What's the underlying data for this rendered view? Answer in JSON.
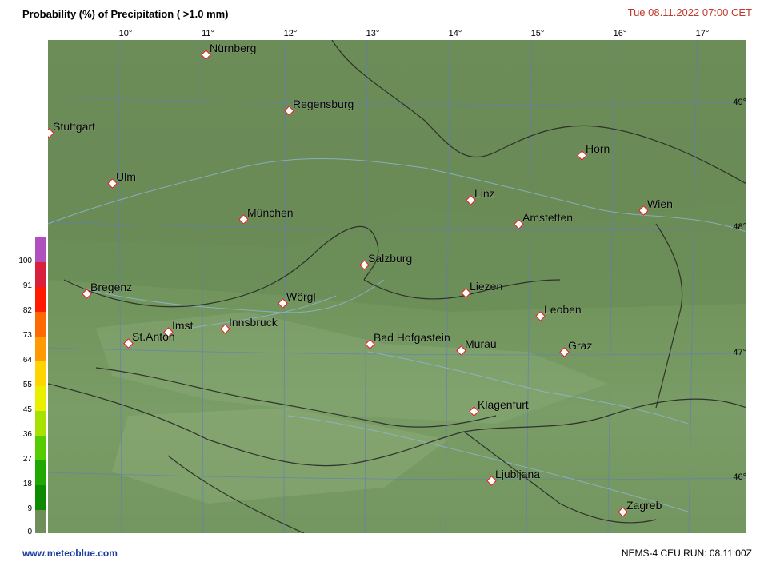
{
  "header": {
    "title": "Probability (%) of Precipitation ( >1.0 mm)",
    "datetime": "Tue 08.11.2022  07:00 CET"
  },
  "lon_labels": [
    "10°",
    "11°",
    "12°",
    "13°",
    "14°",
    "15°",
    "16°",
    "17°"
  ],
  "lat_labels": [
    "49°",
    "48°",
    "47°",
    "46°"
  ],
  "legend": {
    "values": [
      "100",
      "91",
      "82",
      "73",
      "64",
      "55",
      "45",
      "36",
      "27",
      "18",
      "9",
      "0"
    ],
    "colors": [
      "#b04fbf",
      "#d8203c",
      "#ff1a00",
      "#ff6a00",
      "#ff9a00",
      "#ffd400",
      "#e8f000",
      "#a8e000",
      "#55cc00",
      "#1ea800",
      "#0d8a00",
      "#6e8f5a"
    ]
  },
  "cities": [
    {
      "name": "Nürnberg"
    },
    {
      "name": "Regensburg"
    },
    {
      "name": "Stuttgart"
    },
    {
      "name": "Ulm"
    },
    {
      "name": "München"
    },
    {
      "name": "Linz"
    },
    {
      "name": "Horn"
    },
    {
      "name": "Wien"
    },
    {
      "name": "Amstetten"
    },
    {
      "name": "Salzburg"
    },
    {
      "name": "Bregenz"
    },
    {
      "name": "Wörgl"
    },
    {
      "name": "Liezen"
    },
    {
      "name": "Leoben"
    },
    {
      "name": "Imst"
    },
    {
      "name": "Innsbruck"
    },
    {
      "name": "St.Anton"
    },
    {
      "name": "Bad Hofgastein"
    },
    {
      "name": "Murau"
    },
    {
      "name": "Graz"
    },
    {
      "name": "Klagenfurt"
    },
    {
      "name": "Ljubljana"
    },
    {
      "name": "Zagreb"
    }
  ],
  "footer": {
    "site": "www.meteoblue.com",
    "run": "NEMS-4 CEU  RUN: 08.11:00Z"
  }
}
